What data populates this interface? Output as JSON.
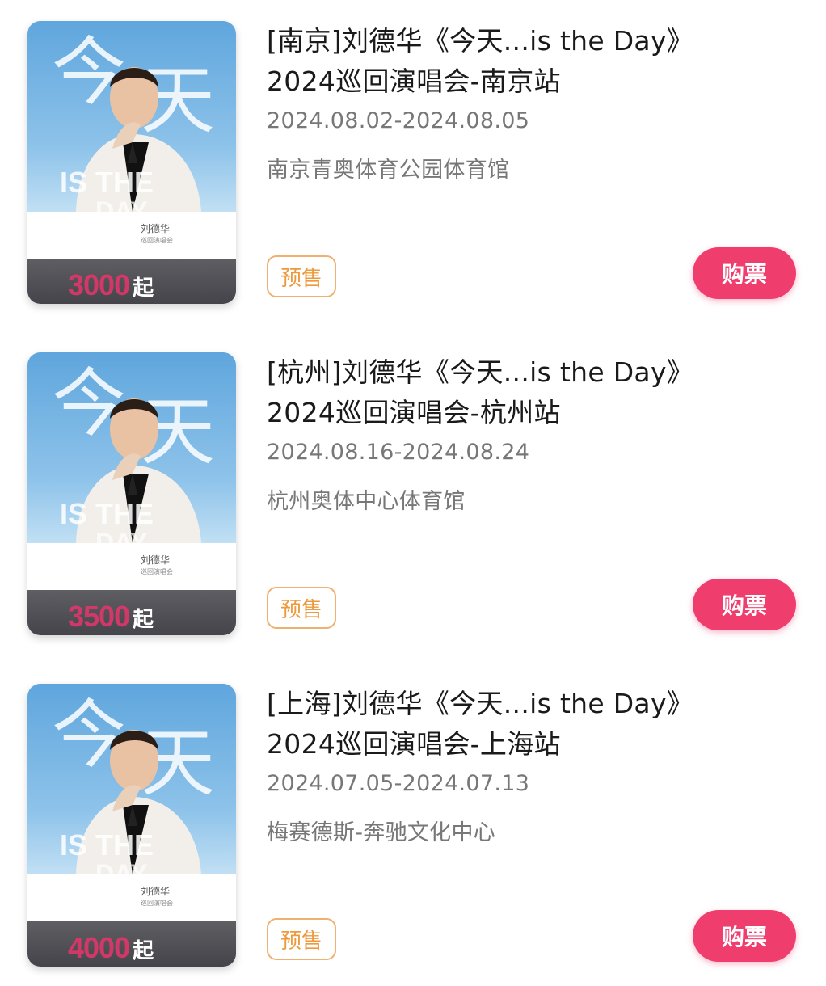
{
  "theme": {
    "buy_button_color": "#ef3d6e",
    "presale_badge_color": "#ee9a3c",
    "price_color": "#e9356b"
  },
  "concerts": [
    {
      "title_line1": "[南京]刘德华《今天...is the Day》",
      "title_line2": "2024巡回演唱会-南京站",
      "date_range": "2024.08.02-2024.08.05",
      "venue": "南京青奥体育公园体育馆",
      "status_badge": "预售",
      "buy_label": "购票",
      "price": "3000",
      "price_suffix": "起",
      "poster_artist": "刘德华",
      "poster_subtitle": "巡回演唱会"
    },
    {
      "title_line1": "[杭州]刘德华《今天...is the Day》",
      "title_line2": "2024巡回演唱会-杭州站",
      "date_range": "2024.08.16-2024.08.24",
      "venue": "杭州奥体中心体育馆",
      "status_badge": "预售",
      "buy_label": "购票",
      "price": "3500",
      "price_suffix": "起",
      "poster_artist": "刘德华",
      "poster_subtitle": "巡回演唱会"
    },
    {
      "title_line1": "[上海]刘德华《今天...is the Day》",
      "title_line2": "2024巡回演唱会-上海站",
      "date_range": "2024.07.05-2024.07.13",
      "venue": "梅赛德斯-奔驰文化中心",
      "status_badge": "预售",
      "buy_label": "购票",
      "price": "4000",
      "price_suffix": "起",
      "poster_artist": "刘德华",
      "poster_subtitle": "巡回演唱会"
    }
  ]
}
